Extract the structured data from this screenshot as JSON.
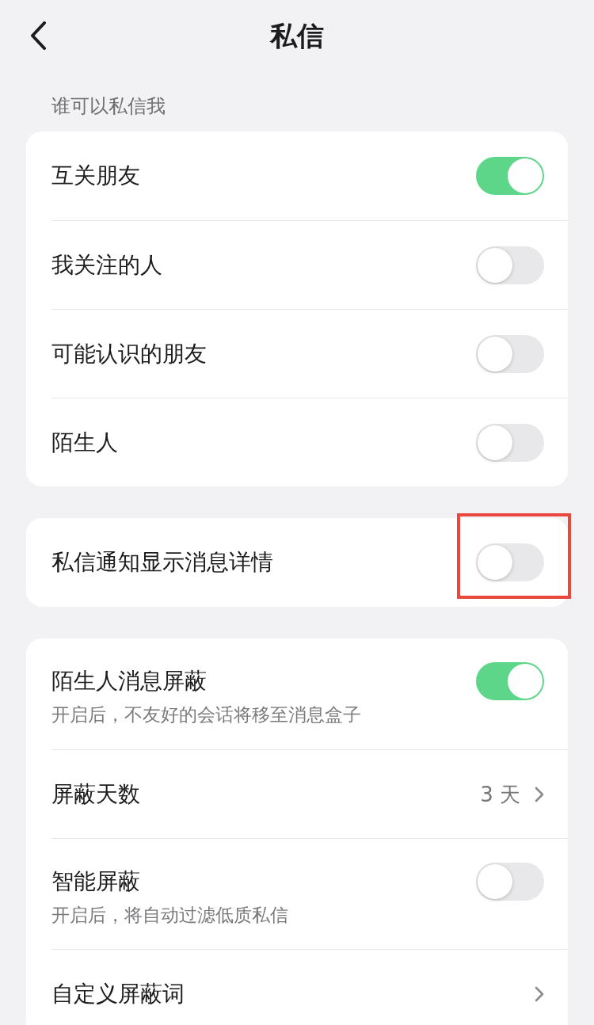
{
  "header": {
    "title": "私信"
  },
  "sections": [
    {
      "heading": "谁可以私信我",
      "items": [
        {
          "kind": "toggle",
          "label": "互关朋友",
          "on": true
        },
        {
          "kind": "toggle",
          "label": "我关注的人",
          "on": false
        },
        {
          "kind": "toggle",
          "label": "可能认识的朋友",
          "on": false
        },
        {
          "kind": "toggle",
          "label": "陌生人",
          "on": false
        }
      ]
    },
    {
      "items": [
        {
          "kind": "toggle",
          "label": "私信通知显示消息详情",
          "on": false,
          "highlighted": true
        }
      ]
    },
    {
      "items": [
        {
          "kind": "toggle",
          "label": "陌生人消息屏蔽",
          "description": "开启后，不友好的会话将移至消息盒子",
          "on": true
        },
        {
          "kind": "link",
          "label": "屏蔽天数",
          "value": "3 天"
        },
        {
          "kind": "toggle",
          "label": "智能屏蔽",
          "description": "开启后，将自动过滤低质私信",
          "on": false
        },
        {
          "kind": "link",
          "label": "自定义屏蔽词"
        }
      ]
    }
  ]
}
